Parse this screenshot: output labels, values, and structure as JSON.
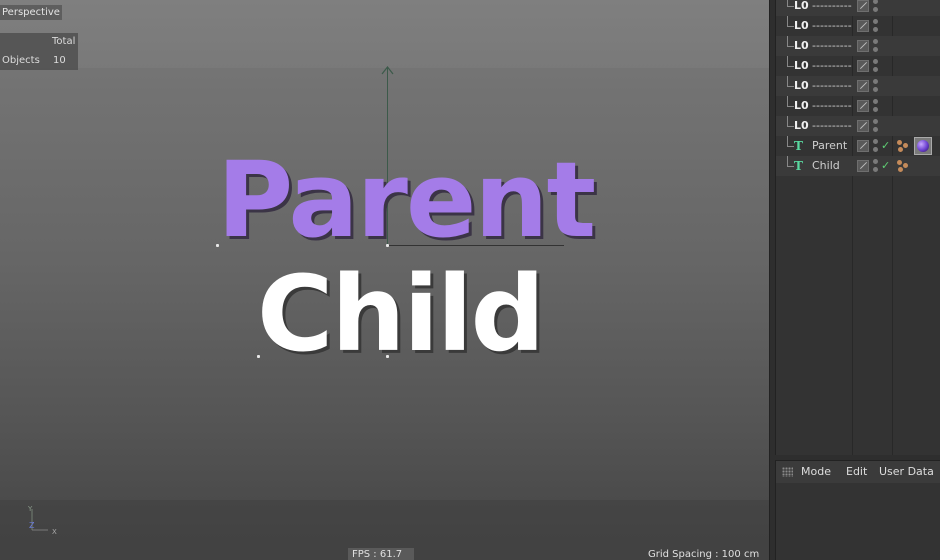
{
  "viewport": {
    "view_label": "Perspective",
    "hud": {
      "total_label": "Total",
      "objects_label": "Objects",
      "objects_count": "10"
    },
    "scene_text": {
      "parent": "Parent",
      "child": "Child"
    },
    "colors": {
      "parent_text": "#a47ce8",
      "child_text": "#ffffff",
      "axis_y": "#3c5a4a"
    },
    "gizmo": {
      "y": "Y",
      "z": "Z",
      "x": "X"
    },
    "status": {
      "fps": "FPS : 61.7",
      "grid_spacing": "Grid Spacing : 100 cm"
    }
  },
  "object_manager": {
    "rows": [
      {
        "icon": "null-icon",
        "glyph": "L0",
        "name": "----------",
        "type": "null"
      },
      {
        "icon": "null-icon",
        "glyph": "L0",
        "name": "----------",
        "type": "null"
      },
      {
        "icon": "null-icon",
        "glyph": "L0",
        "name": "----------",
        "type": "null"
      },
      {
        "icon": "null-icon",
        "glyph": "L0",
        "name": "----------",
        "type": "null"
      },
      {
        "icon": "null-icon",
        "glyph": "L0",
        "name": "----------",
        "type": "null"
      },
      {
        "icon": "null-icon",
        "glyph": "L0",
        "name": "----------",
        "type": "null"
      },
      {
        "icon": "null-icon",
        "glyph": "L0",
        "name": "----------",
        "type": "null"
      },
      {
        "icon": "text-spline-icon",
        "glyph": "T",
        "name": "Parent",
        "type": "text",
        "check": "✓",
        "has_material": true
      },
      {
        "icon": "text-spline-icon",
        "glyph": "T",
        "name": "Child",
        "type": "text",
        "check": "✓",
        "has_material": false
      }
    ]
  },
  "attribute_manager": {
    "menu": {
      "mode": "Mode",
      "edit": "Edit",
      "user_data": "User Data"
    }
  }
}
